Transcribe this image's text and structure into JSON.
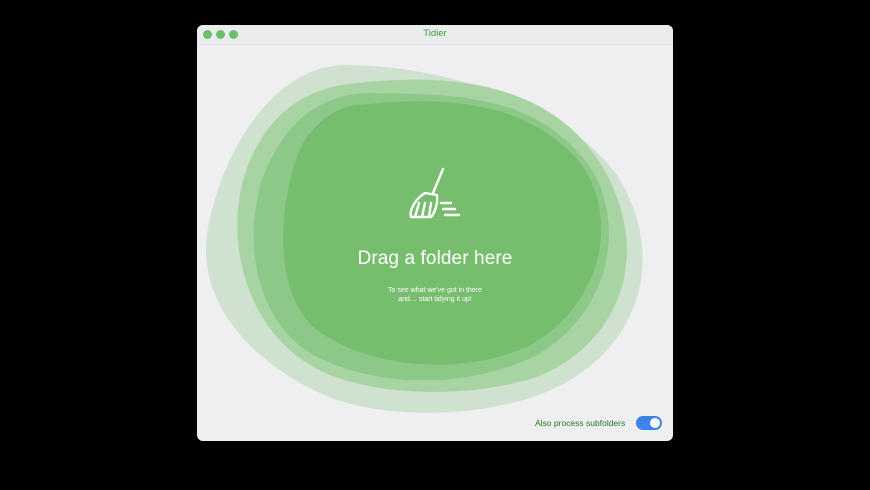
{
  "window": {
    "title": "Tidier",
    "traffic_light_color": "#6cc06c"
  },
  "dropzone": {
    "icon": "broom-icon",
    "headline": "Drag a folder here",
    "subtitle_line1": "To see what we've got in there",
    "subtitle_line2": "and… start tidying it up!",
    "colors": {
      "outer": "#cfe2cf",
      "mid": "#a1d09e",
      "inner": "#74bd6c"
    }
  },
  "options": {
    "subfolders_label": "Also process subfolders",
    "subfolders_enabled": true,
    "toggle_color": "#3f83e8"
  }
}
